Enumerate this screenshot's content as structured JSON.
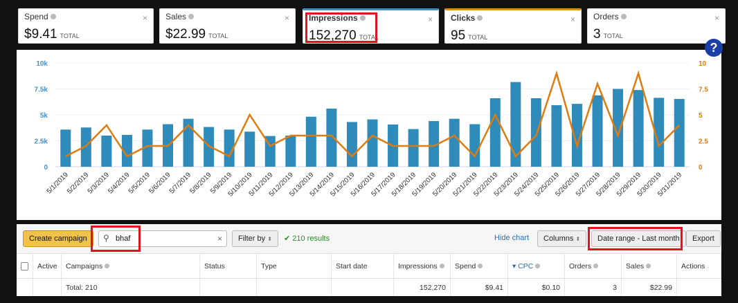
{
  "metrics": [
    {
      "label": "Spend",
      "value": "$9.41",
      "suffix": "TOTAL"
    },
    {
      "label": "Sales",
      "value": "$22.99",
      "suffix": "TOTAL"
    },
    {
      "label": "Impressions",
      "value": "152,270",
      "suffix": "TOTAL"
    },
    {
      "label": "Clicks",
      "value": "95",
      "suffix": "TOTAL"
    },
    {
      "label": "Orders",
      "value": "3",
      "suffix": "TOTAL"
    }
  ],
  "close_glyph": "×",
  "help_glyph": "?",
  "colors": {
    "bars": "#2e8bba",
    "line": "#e07b0f",
    "highlight": "#e0141e"
  },
  "chart_data": {
    "type": "bar+line",
    "categories": [
      "5/1/2019",
      "5/2/2019",
      "5/3/2019",
      "5/4/2019",
      "5/5/2019",
      "5/6/2019",
      "5/7/2019",
      "5/8/2019",
      "5/9/2019",
      "5/10/2019",
      "5/11/2019",
      "5/12/2019",
      "5/13/2019",
      "5/14/2019",
      "5/15/2019",
      "5/16/2019",
      "5/17/2019",
      "5/18/2019",
      "5/19/2019",
      "5/20/2019",
      "5/21/2019",
      "5/22/2019",
      "5/23/2019",
      "5/24/2019",
      "5/25/2019",
      "5/26/2019",
      "5/27/2019",
      "5/28/2019",
      "5/29/2019",
      "5/30/2019",
      "5/31/2019"
    ],
    "series": [
      {
        "name": "Impressions",
        "axis": "left",
        "type": "bar",
        "values": [
          3580,
          3780,
          3000,
          3070,
          3580,
          4100,
          4620,
          3830,
          3580,
          3380,
          2960,
          3000,
          4820,
          5600,
          4310,
          4560,
          4070,
          3630,
          4400,
          4620,
          4100,
          6600,
          8160,
          6600,
          5930,
          6060,
          6880,
          7500,
          7390,
          6640,
          6530
        ]
      },
      {
        "name": "Clicks",
        "axis": "right",
        "type": "line",
        "values": [
          1,
          2,
          4,
          1,
          2,
          2,
          4,
          2,
          1,
          5,
          2,
          3,
          3,
          3,
          1,
          3,
          2,
          2,
          2,
          3,
          1,
          5,
          1,
          3,
          9,
          2,
          8,
          3,
          9,
          2,
          4
        ]
      }
    ],
    "left_axis": {
      "ticks": [
        "0",
        "2.5k",
        "5k",
        "7.5k",
        "10k"
      ],
      "range": [
        0,
        10000
      ]
    },
    "right_axis": {
      "ticks": [
        "0",
        "2.5",
        "5",
        "7.5",
        "10"
      ],
      "range": [
        0,
        10
      ]
    },
    "grid": true
  },
  "toolbar": {
    "create": "Create campaign",
    "search_value": "bhaf",
    "clear": "×",
    "filter": "Filter by",
    "results": "✔ 210 results",
    "hide_chart": "Hide chart",
    "columns": "Columns",
    "date_range": "Date range - Last month",
    "export": "Export"
  },
  "table": {
    "headers": [
      "Active",
      "Campaigns",
      "Status",
      "Type",
      "Start date",
      "Impressions",
      "Spend",
      "▾ CPC",
      "Orders",
      "Sales",
      "Actions"
    ],
    "total": {
      "campaigns": "Total: 210",
      "impressions": "152,270",
      "spend": "$9.41",
      "cpc": "$0.10",
      "orders": "3",
      "sales": "$22.99"
    }
  }
}
